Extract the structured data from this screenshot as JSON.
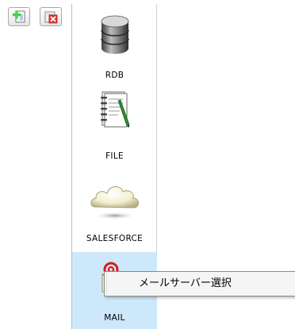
{
  "toolbar": {
    "add_icon": "add-document-icon",
    "delete_icon": "delete-document-icon"
  },
  "palette": {
    "items": [
      {
        "label": "RDB",
        "icon": "database-icon"
      },
      {
        "label": "FILE",
        "icon": "notebook-file-icon"
      },
      {
        "label": "SALESFORCE",
        "icon": "cloud-icon"
      },
      {
        "label": "MAIL",
        "icon": "mail-envelope-icon",
        "selected": true
      }
    ]
  },
  "context_menu": {
    "items": [
      {
        "label": "メールサーバー選択"
      }
    ]
  },
  "colors": {
    "selected_background": "#cde8fb",
    "menu_background": "#f5f5f5"
  }
}
